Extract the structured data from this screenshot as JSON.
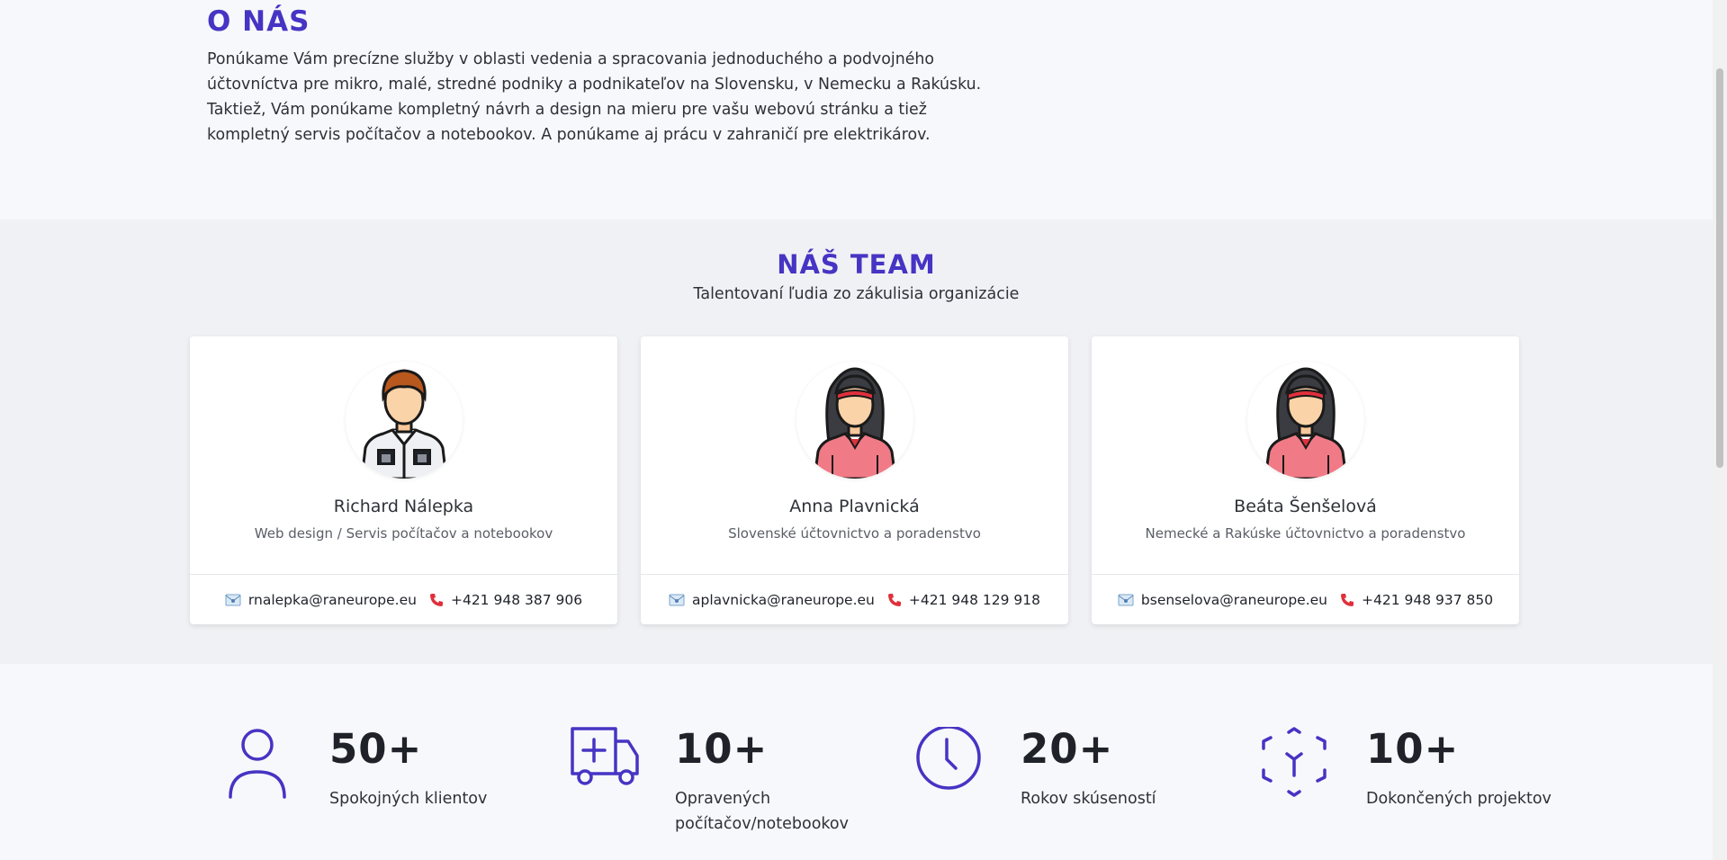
{
  "about": {
    "title": "O NÁS",
    "text": "Ponúkame Vám precízne služby v oblasti vedenia a spracovania jednoduchého a podvojného účtovníctva pre mikro, malé, stredné podniky a podnikateľov na Slovensku, v Nemecku a Rakúsku. Taktiež, Vám ponúkame kompletný návrh a design na mieru pre vašu webovú stránku a tiež kompletný servis počítačov a notebookov. A ponúkame aj prácu v zahraničí pre elektrikárov."
  },
  "team": {
    "title": "NÁŠ TEAM",
    "subtitle": "Talentovaní ľudia zo zákulisia organizácie",
    "members": [
      {
        "name": "Richard Nálepka",
        "role": "Web design / Servis počítačov a notebookov",
        "email": "rnalepka@raneurope.eu",
        "phone": "+421 948 387 906",
        "avatar": "male-avatar"
      },
      {
        "name": "Anna Plavnická",
        "role": "Slovenské účtovnictvo a poradenstvo",
        "email": "aplavnicka@raneurope.eu",
        "phone": "+421 948 129 918",
        "avatar": "female-avatar"
      },
      {
        "name": "Beáta Šenšelová",
        "role": "Nemecké a Rakúske účtovnictvo a poradenstvo",
        "email": "bsenselova@raneurope.eu",
        "phone": "+421 948 937 850",
        "avatar": "female-avatar"
      }
    ]
  },
  "stats": [
    {
      "number": "50+",
      "label": "Spokojných klientov",
      "icon": "user-icon"
    },
    {
      "number": "10+",
      "label": "Opravených počítačov/notebookov",
      "icon": "ambulance-icon"
    },
    {
      "number": "20+",
      "label": "Rokov skúseností",
      "icon": "clock-icon"
    },
    {
      "number": "10+",
      "label": "Dokončených projektov",
      "icon": "box-icon"
    }
  ],
  "colors": {
    "accent": "#4634c4",
    "phone": "#e0303c",
    "about_bg": "#f7f8fb",
    "team_bg": "#f0f1f4"
  }
}
